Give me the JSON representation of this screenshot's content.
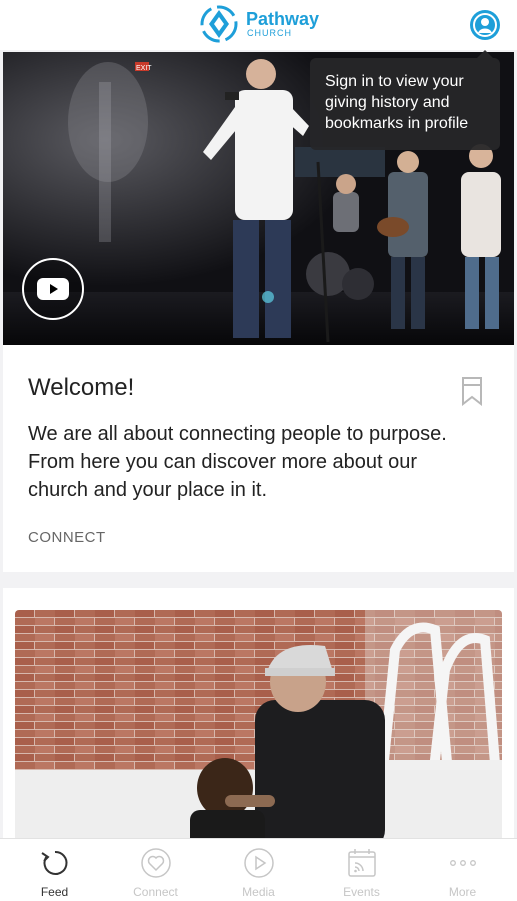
{
  "header": {
    "brand_name": "Pathway",
    "brand_sub": "CHURCH"
  },
  "tooltip": {
    "text": "Sign in to view your giving history and bookmarks in profile"
  },
  "hero": {
    "exit_sign": "EXIT"
  },
  "card": {
    "title": "Welcome!",
    "body": "We are all about connecting people to purpose. From here you can discover more about our church and your place in it.",
    "tag": "CONNECT"
  },
  "tabs": [
    {
      "label": "Feed",
      "icon": "refresh-icon",
      "active": true
    },
    {
      "label": "Connect",
      "icon": "heart-circle-icon",
      "active": false
    },
    {
      "label": "Media",
      "icon": "play-circle-icon",
      "active": false
    },
    {
      "label": "Events",
      "icon": "calendar-feed-icon",
      "active": false
    },
    {
      "label": "More",
      "icon": "more-dots-icon",
      "active": false
    }
  ],
  "colors": {
    "brand": "#1e9fd9",
    "tab_active": "#333333",
    "tab_inactive": "#c6c6c6"
  }
}
